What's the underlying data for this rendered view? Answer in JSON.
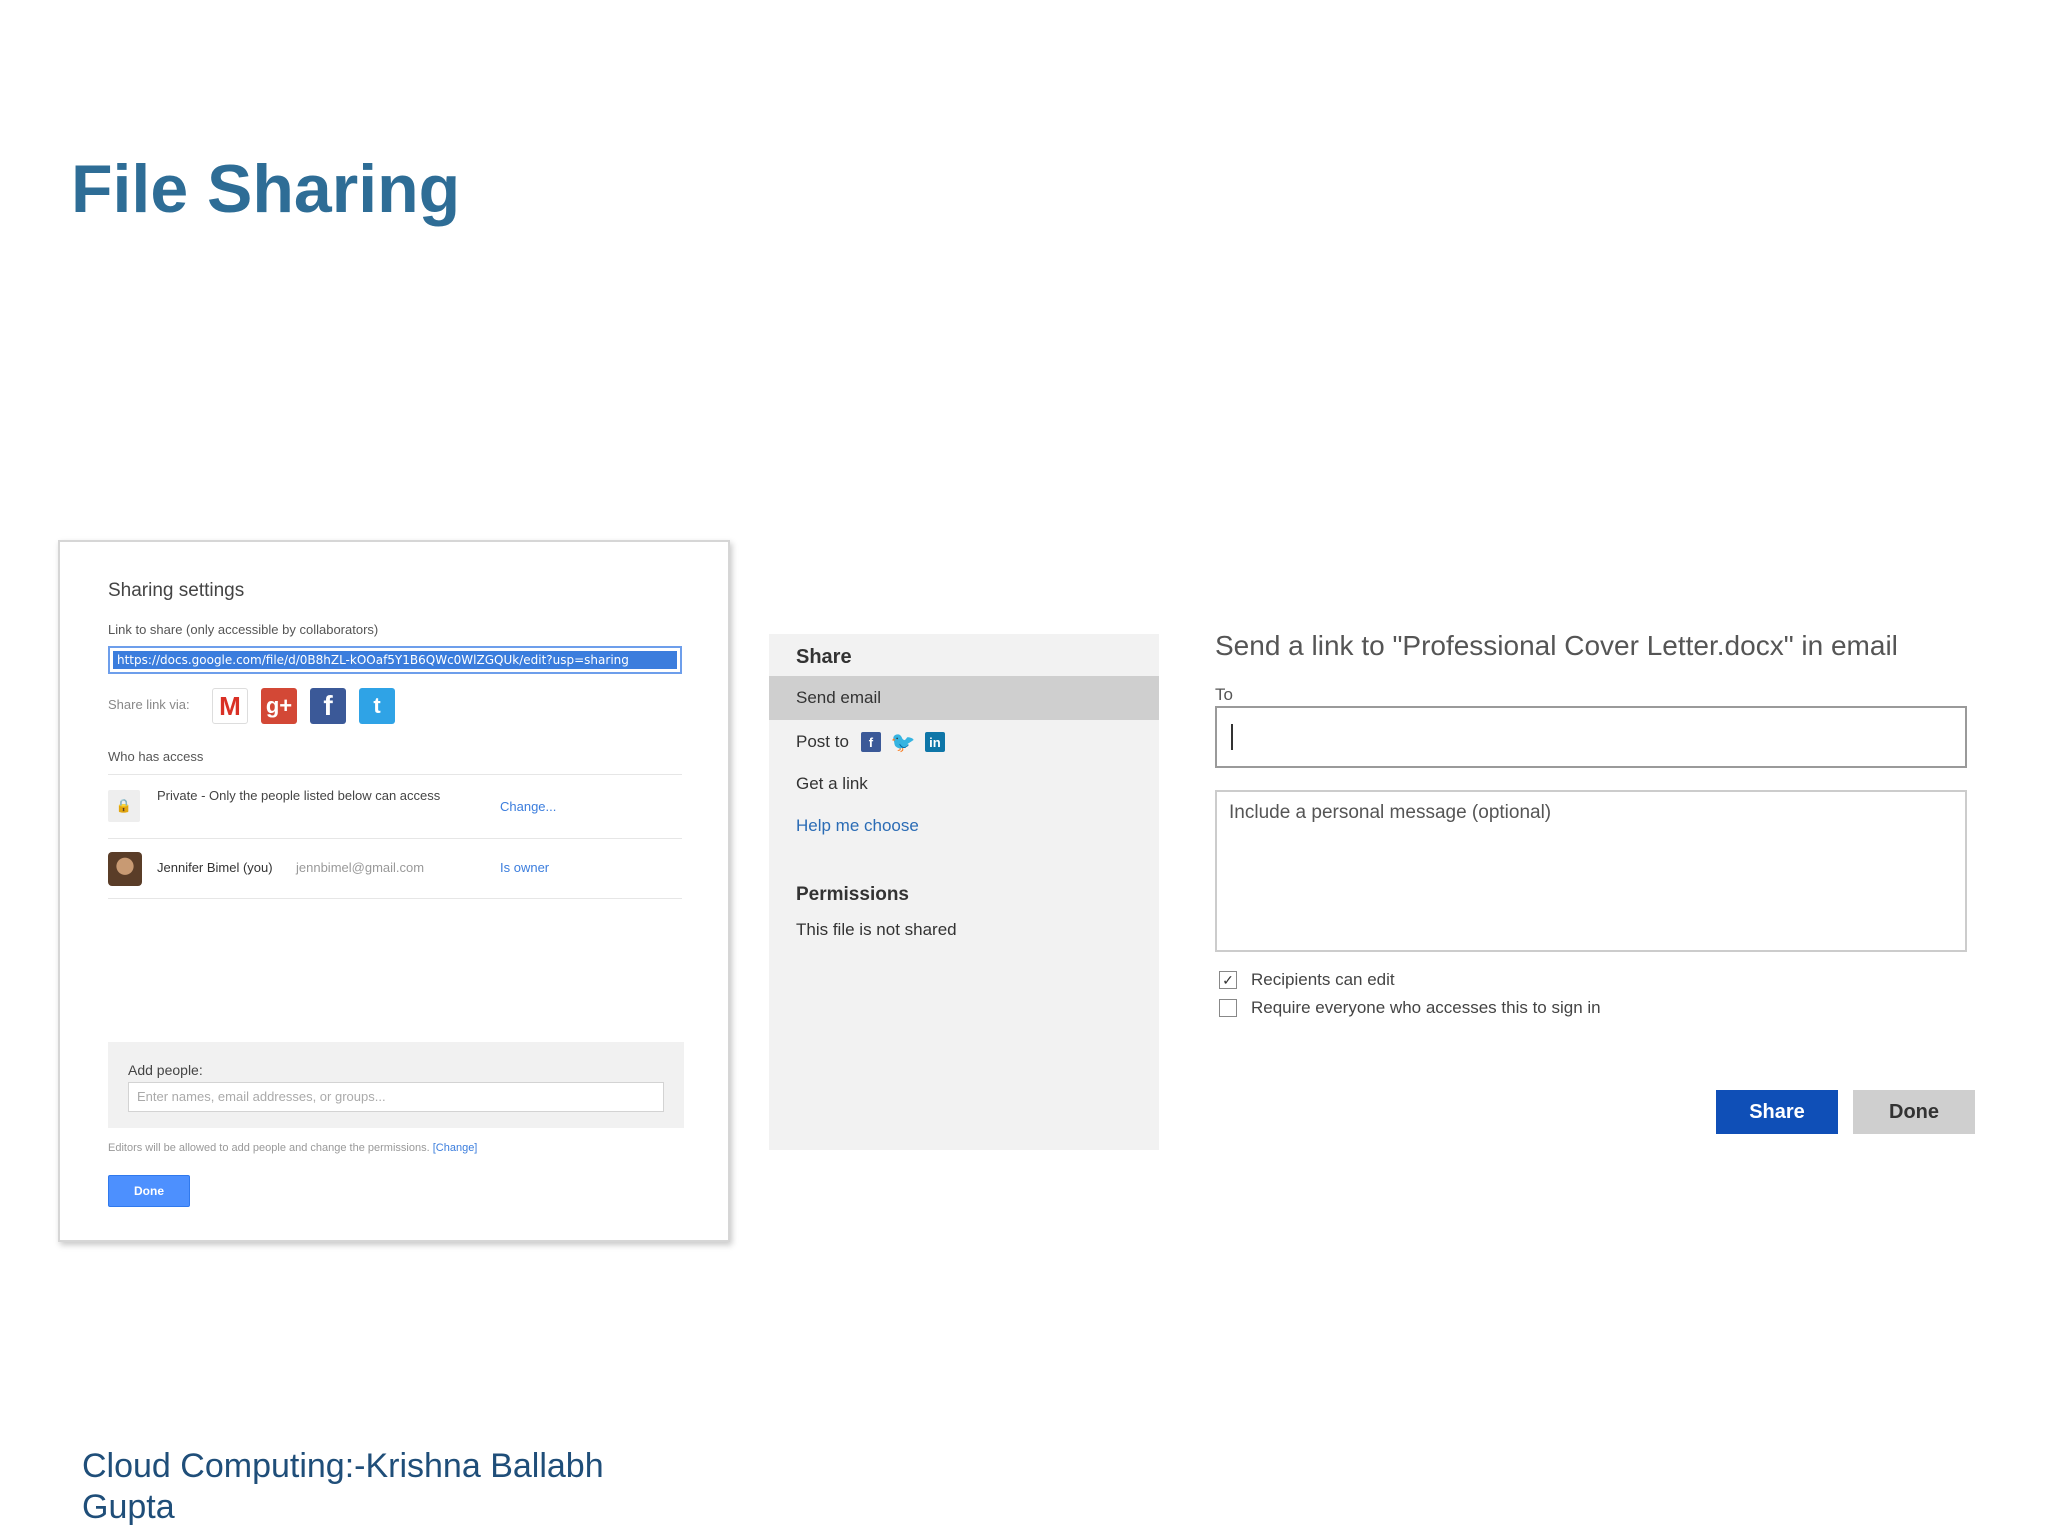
{
  "slide": {
    "title": "File Sharing",
    "footer": "Cloud Computing:-Krishna Ballabh Gupta"
  },
  "google_dialog": {
    "title": "Sharing settings",
    "link_label": "Link to share (only accessible by collaborators)",
    "link_url": "https://docs.google.com/file/d/0B8hZL-kOOaf5Y1B6QWc0WlZGQUk/edit?usp=sharing",
    "share_via_label": "Share link via:",
    "share_icons": [
      "gmail-icon",
      "google-plus-icon",
      "facebook-icon",
      "twitter-icon"
    ],
    "share_glyphs": {
      "gmail": "M",
      "gplus": "g+",
      "facebook": "f",
      "twitter": "t"
    },
    "who_has_access": "Who has access",
    "private_text": "Private - Only the people listed below can access",
    "change_link": "Change...",
    "user_name": "Jennifer Bimel (you)",
    "user_email": "jennbimel@gmail.com",
    "user_role": "Is owner",
    "add_people_label": "Add people:",
    "add_people_placeholder": "Enter names, email addresses, or groups...",
    "editors_note": "Editors will be allowed to add people and change the permissions.",
    "editors_change": "[Change]",
    "done_button": "Done",
    "colors": {
      "accent": "#4d90fe",
      "selection": "#3b7ddd"
    }
  },
  "onedrive_sidebar": {
    "heading": "Share",
    "items": {
      "send_email": "Send email",
      "post_to": "Post to",
      "get_link": "Get a link",
      "help": "Help me choose"
    },
    "post_icons": [
      "facebook-icon",
      "twitter-icon",
      "linkedin-icon"
    ],
    "post_glyphs": {
      "facebook": "f",
      "twitter": "t",
      "linkedin": "in"
    },
    "permissions_heading": "Permissions",
    "permissions_status": "This file is not shared"
  },
  "onedrive_email": {
    "title": "Send a link to \"Professional Cover Letter.docx\" in email",
    "to_label": "To",
    "to_value": "",
    "message_placeholder": "Include a personal message (optional)",
    "recipients_can_edit": "Recipients can edit",
    "recipients_can_edit_checked": true,
    "require_signin": "Require everyone who accesses this to sign in",
    "require_signin_checked": false,
    "share_button": "Share",
    "done_button": "Done",
    "colors": {
      "primary": "#0f4fb7",
      "secondary": "#cfcfcf"
    }
  }
}
